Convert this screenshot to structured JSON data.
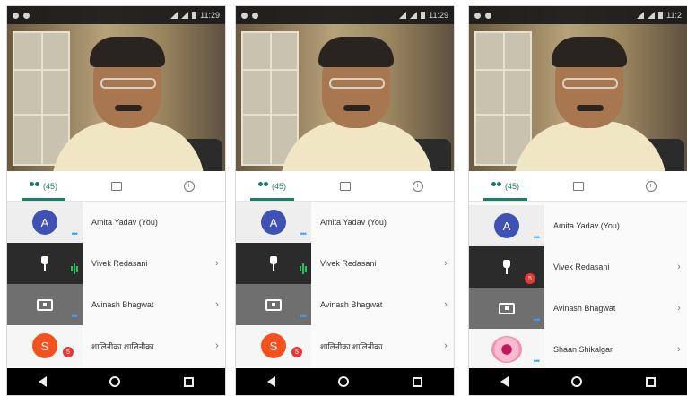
{
  "colors": {
    "accent": "#1a7f64",
    "avatar_blue": "#3f51b5",
    "avatar_orange": "#f4511e",
    "badge_red": "#e53935",
    "audio_green": "#22c35e"
  },
  "icons": {
    "participants": "people-icon",
    "chat": "chat-icon",
    "info": "info-icon",
    "pin": "pin-icon",
    "screen_share": "screen-share-icon",
    "chevron": "chevron-right-icon",
    "back": "back-icon",
    "home": "home-icon",
    "recents": "recents-icon"
  },
  "screens": [
    {
      "status_time": "11:29",
      "participants_count": "(45)",
      "rows": [
        {
          "avatar_letter": "A",
          "name": "Amita Yadav (You)",
          "thumb": "light",
          "show_chevron": false
        },
        {
          "name": "Vivek Redasani",
          "thumb": "dark",
          "show_chevron": true,
          "chevron": "›"
        },
        {
          "name": "Avinash Bhagwat",
          "thumb": "screen",
          "show_chevron": true,
          "chevron": "›"
        },
        {
          "avatar_letter": "S",
          "name": "शालिनीका शालिनीका",
          "thumb": "white",
          "show_chevron": true,
          "chevron": "›",
          "badge": "5"
        }
      ]
    },
    {
      "status_time": "11:29",
      "participants_count": "(45)",
      "rows": [
        {
          "avatar_letter": "A",
          "name": "Amita Yadav (You)",
          "thumb": "light",
          "show_chevron": false
        },
        {
          "name": "Vivek Redasani",
          "thumb": "dark",
          "show_chevron": true,
          "chevron": "›"
        },
        {
          "name": "Avinash Bhagwat",
          "thumb": "screen",
          "show_chevron": true,
          "chevron": "›"
        },
        {
          "avatar_letter": "S",
          "name": "शालिनीका शालिनीका",
          "thumb": "white",
          "show_chevron": true,
          "chevron": "›",
          "badge": "5"
        }
      ]
    },
    {
      "status_time": "11:2",
      "participants_count": "(45)",
      "rows": [
        {
          "avatar_letter": "A",
          "name": "Amita Yadav (You)",
          "thumb": "light",
          "show_chevron": false
        },
        {
          "name": "Vivek Redasani",
          "thumb": "dark",
          "show_chevron": true,
          "chevron": "›",
          "badge": "5"
        },
        {
          "name": "Avinash Bhagwat",
          "thumb": "screen",
          "show_chevron": true,
          "chevron": "›"
        },
        {
          "name": "Shaan Shikalgar",
          "thumb": "flower",
          "show_chevron": true,
          "chevron": "›"
        }
      ]
    }
  ]
}
